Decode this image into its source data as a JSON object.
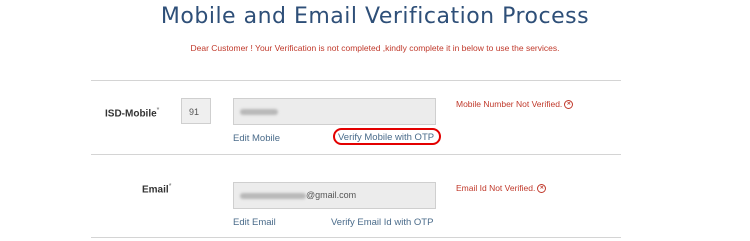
{
  "page": {
    "title": "Mobile and Email Verification Process",
    "notice": "Dear Customer ! Your Verification is not completed ,kindly complete it in below to use the services."
  },
  "mobile": {
    "label": "ISD-Mobile",
    "required_mark": "*",
    "isd_value": "91",
    "edit_link": "Edit Mobile",
    "verify_link": "Verify Mobile with OTP",
    "status": "Mobile Number Not Verified.",
    "status_icon": "error-circle-icon"
  },
  "email": {
    "label": "Email",
    "required_mark": "*",
    "value_domain": "@gmail.com",
    "edit_link": "Edit Email",
    "verify_link": "Verify Email Id with OTP",
    "status": "Email Id Not Verified.",
    "status_icon": "error-circle-icon"
  },
  "colors": {
    "title": "#2e4f78",
    "error": "#c0392b",
    "link": "#4a6b8a",
    "highlight": "#e30000"
  }
}
